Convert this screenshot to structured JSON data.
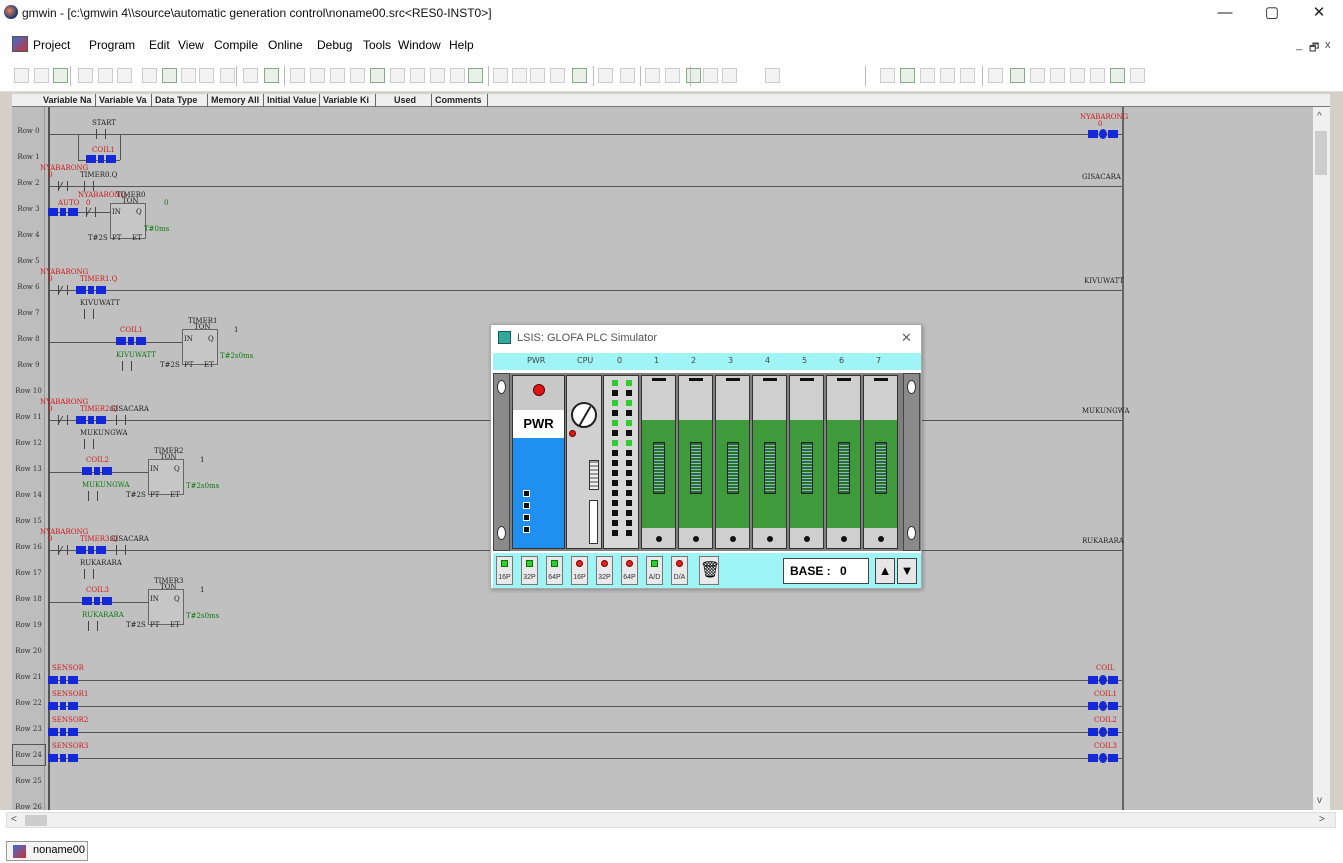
{
  "window": {
    "title": "gmwin - [c:\\gmwin 4\\\\source\\automatic generation control\\noname00.src<RES0-INST0>]",
    "minimize": "—",
    "maximize": "▢",
    "close": "✕"
  },
  "menu": {
    "items": [
      "Project",
      "Program",
      "Edit",
      "View",
      "Compile",
      "Online",
      "Debug",
      "Tools",
      "Window",
      "Help"
    ],
    "mdi": [
      "_",
      "🗗",
      "x"
    ]
  },
  "columns": [
    "Variable Na",
    "Variable Va",
    "Data Type",
    "Memory All",
    "Initial Value",
    "Variable Ki",
    "Used",
    "Comments"
  ],
  "rows": [
    "Row 0",
    "Row 1",
    "Row 2",
    "Row 3",
    "Row 4",
    "Row 5",
    "Row 6",
    "Row 7",
    "Row 8",
    "Row 9",
    "Row 10",
    "Row 11",
    "Row 12",
    "Row 13",
    "Row 14",
    "Row 15",
    "Row 16",
    "Row 17",
    "Row 18",
    "Row 19",
    "Row 20",
    "Row 21",
    "Row 22",
    "Row 23",
    "Row 24",
    "Row 25",
    "Row 26"
  ],
  "ladder": {
    "start": "START",
    "coil1": "COIL1",
    "nyabarong": "NYABARONG",
    "zero": "0",
    "timer0q": "TIMER0.Q",
    "timer0": "TIMER0",
    "ton": "TON",
    "auto": "AUTO",
    "in": "IN",
    "q": "Q",
    "pt": "PT",
    "et": "ET",
    "t2s": "T#2S",
    "t0ms": "T#0ms",
    "timer1q": "TIMER1.Q",
    "kivuwatt": "KIVUWATT",
    "timer1": "TIMER1",
    "one": "1",
    "t2s0ms": "T#2s0ms",
    "timer2q": "TIMER2.Q",
    "gisacara": "GISACARA",
    "mukungwa": "MUKUNGWA",
    "coil2": "COIL2",
    "timer2": "TIMER2",
    "timer3q": "TIMER3.Q",
    "rukarara": "RUKARARA",
    "coil3": "COIL3",
    "timer3": "TIMER3",
    "sensor": "SENSOR",
    "sensor1": "SENSOR1",
    "sensor2": "SENSOR2",
    "sensor3": "SENSOR3",
    "coil": "COIL",
    "out_nyabarong": "NYABARONG",
    "out_gisacara": "GISACARA",
    "out_kivuwatt": "KIVUWATT",
    "out_mukungwa": "MUKUNGWA",
    "out_rukarara": "RUKARARA",
    "out_coil": "COIL",
    "out_coil1": "COIL1",
    "out_coil2": "COIL2",
    "out_coil3": "COIL3"
  },
  "simulator": {
    "title": "LSIS: GLOFA PLC Simulator",
    "close": "✕",
    "slots": [
      "PWR",
      "CPU",
      "0",
      "1",
      "2",
      "3",
      "4",
      "5",
      "6",
      "7"
    ],
    "power_label": "PWR",
    "buttons": [
      "16P",
      "32P",
      "64P",
      "16P",
      "32P",
      "64P",
      "A/D",
      "D/A"
    ],
    "base_label": "BASE :",
    "base_value": "0",
    "up": "▲",
    "down": "▼"
  },
  "statusbar": {
    "tab": "noname00"
  },
  "colors": {
    "coil_blue": "#1428d8",
    "var_red": "#d01818",
    "const_green": "#0a7a0a",
    "module_green": "#3f9a3c",
    "sim_cyan": "#9ff4f6"
  }
}
